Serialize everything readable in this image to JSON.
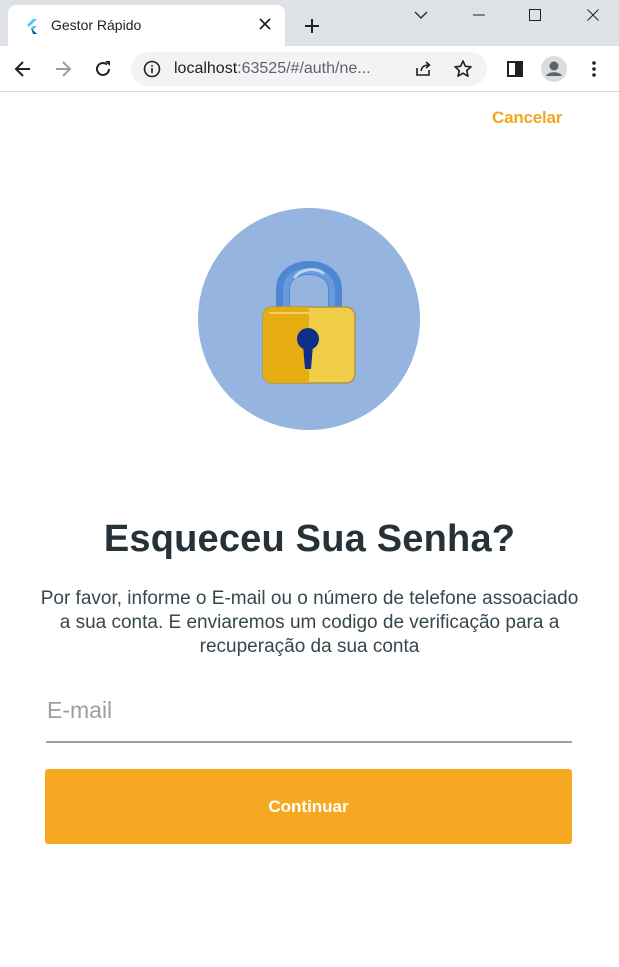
{
  "browser": {
    "tab_title": "Gestor Rápido",
    "url_host": "localhost",
    "url_path": ":63525/#/auth/ne..."
  },
  "icons": {
    "tab_favicon": "flutter-logo-icon",
    "tab_close": "close-icon",
    "new_tab": "plus-icon",
    "back": "arrow-left-icon",
    "forward": "arrow-right-icon",
    "reload": "reload-icon",
    "site_info": "info-icon",
    "share": "share-icon",
    "bookmark": "star-icon",
    "side_panel": "side-panel-icon",
    "profile": "profile-avatar-icon",
    "menu": "more-vertical-icon",
    "lock": "padlock-icon"
  },
  "page": {
    "cancel_label": "Cancelar",
    "title": "Esqueceu Sua Senha?",
    "description": "Por favor, informe o E-mail ou o número de telefone assoaciado a sua conta. E enviaremos um codigo de verificação para a recuperação da sua conta",
    "email_placeholder": "E-mail",
    "email_value": "",
    "continue_label": "Continuar"
  },
  "colors": {
    "accent": "#f6a822",
    "title": "#263238",
    "lock_circle": "#96b4e0",
    "lock_body": "#f0c93c",
    "lock_shackle": "#5b8fd8"
  }
}
